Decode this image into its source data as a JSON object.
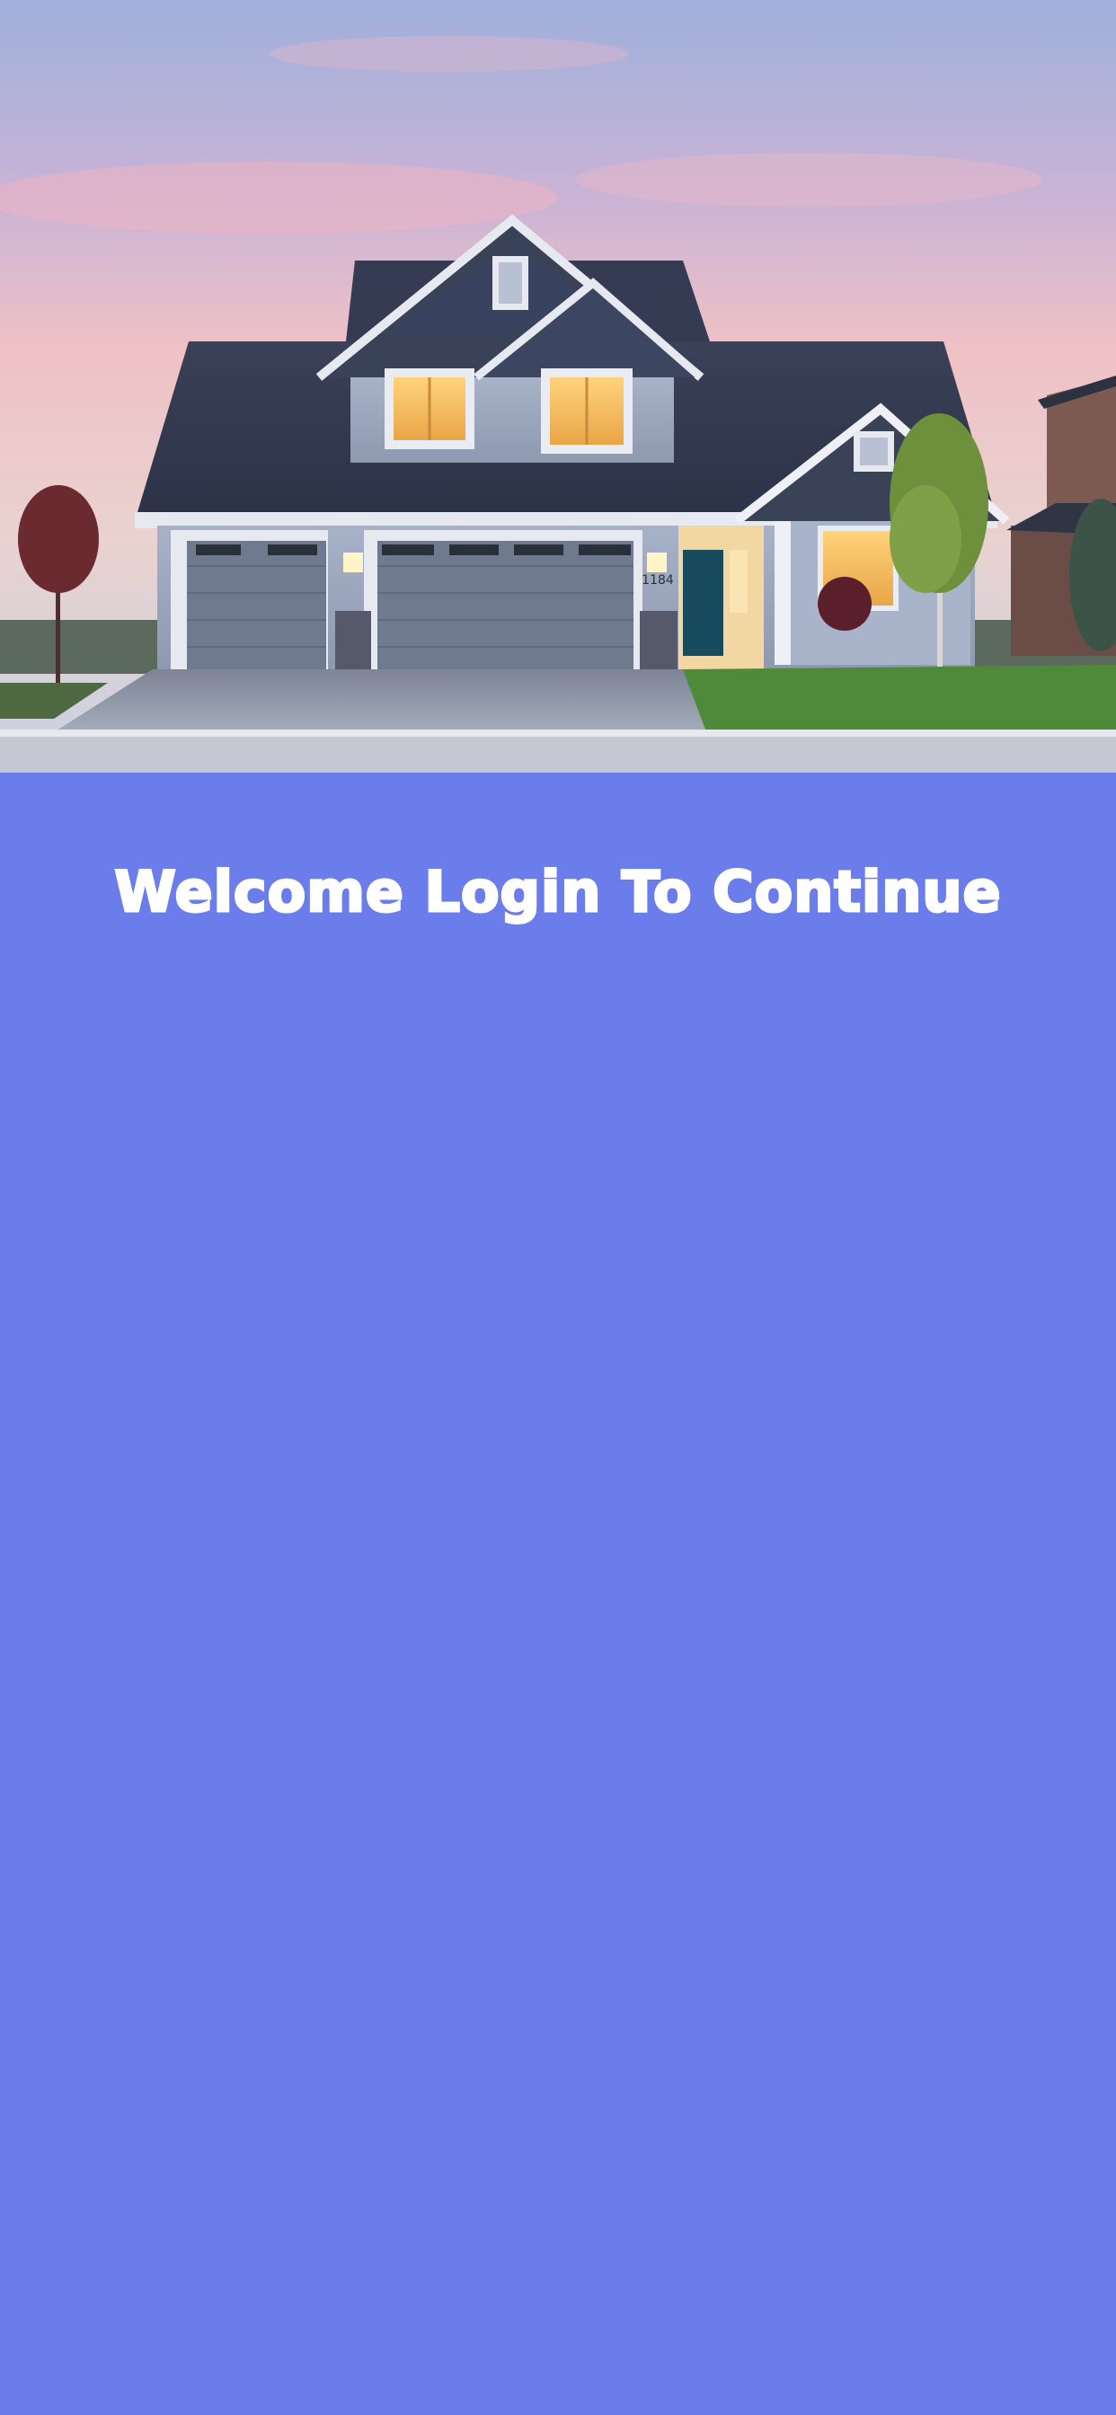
{
  "hero": {
    "image_subject": "house-photo",
    "house_number": "1184"
  },
  "login": {
    "welcome_title": "Welcome Login To Continue"
  },
  "colors": {
    "panel_background": "#6a7deb",
    "title_text": "#ffffff"
  }
}
